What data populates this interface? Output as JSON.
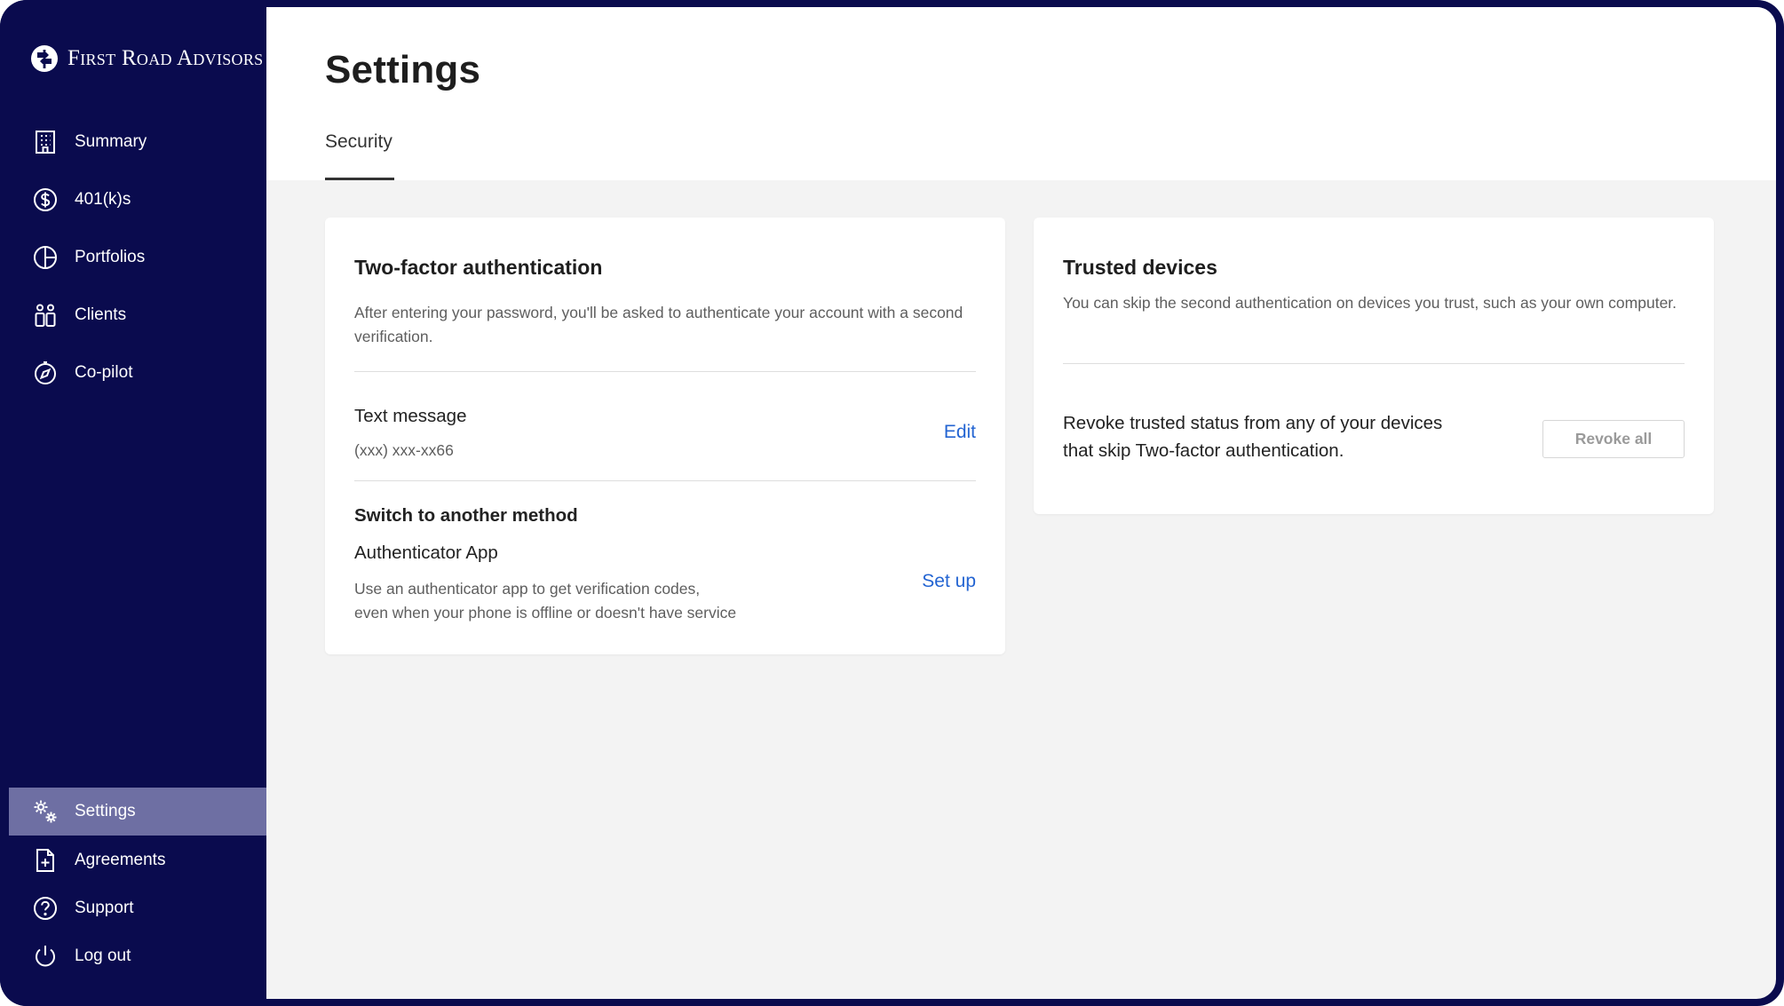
{
  "brand": {
    "name": "First Road Advisors"
  },
  "sidebar": {
    "top_items": [
      {
        "label": "Summary",
        "icon": "building-icon"
      },
      {
        "label": "401(k)s",
        "icon": "dollar-circle-icon"
      },
      {
        "label": "Portfolios",
        "icon": "pie-chart-icon"
      },
      {
        "label": "Clients",
        "icon": "people-icon"
      },
      {
        "label": "Co-pilot",
        "icon": "compass-icon"
      }
    ],
    "bottom_items": [
      {
        "label": "Settings",
        "icon": "gears-icon",
        "active": true
      },
      {
        "label": "Agreements",
        "icon": "document-add-icon"
      },
      {
        "label": "Support",
        "icon": "question-circle-icon"
      },
      {
        "label": "Log out",
        "icon": "power-icon"
      }
    ]
  },
  "page": {
    "title": "Settings",
    "tabs": [
      {
        "label": "Security",
        "active": true
      }
    ]
  },
  "two_factor": {
    "title": "Two-factor authentication",
    "description": "After entering your password, you'll be asked to authenticate your account with a second verification.",
    "method": {
      "title": "Text message",
      "value": "(xxx) xxx-xx66",
      "action": "Edit"
    },
    "switch": {
      "title": "Switch to another method",
      "option_title": "Authenticator App",
      "option_desc_line1": "Use an authenticator app to get verification codes,",
      "option_desc_line2": "even when your phone is offline or doesn't have service",
      "action": "Set up"
    }
  },
  "trusted_devices": {
    "title": "Trusted devices",
    "description": "You can skip the second authentication on devices you trust, such as your own computer.",
    "revoke_line1": "Revoke trusted status from any of your devices",
    "revoke_line2": "that skip Two-factor authentication.",
    "revoke_button": "Revoke all"
  },
  "colors": {
    "sidebar_bg": "#0a0b4e",
    "sidebar_active": "#6e6fa3",
    "content_bg": "#f3f3f3",
    "link": "#2364d2"
  }
}
